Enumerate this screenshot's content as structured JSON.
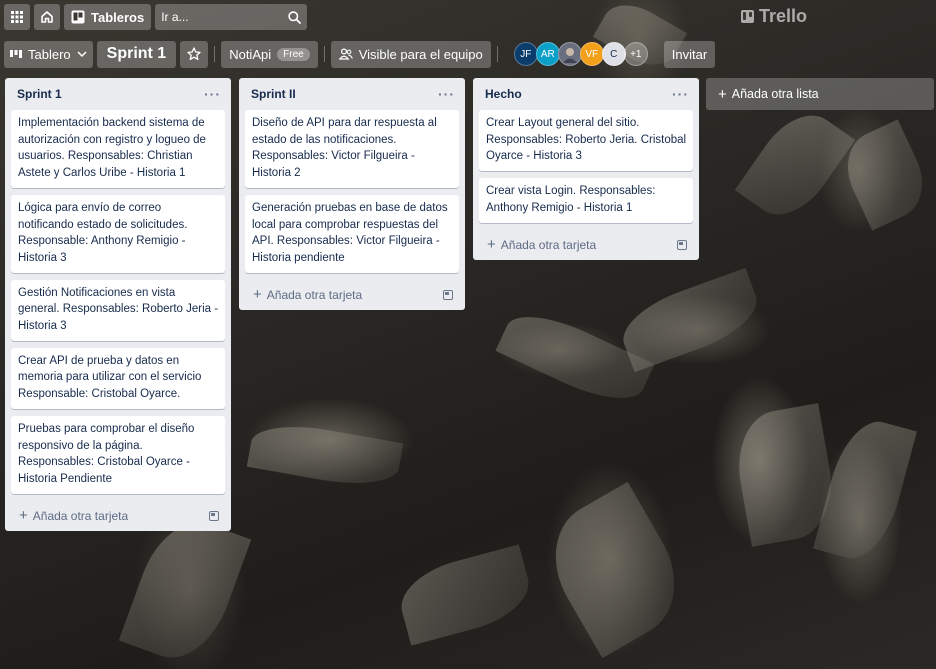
{
  "topbar": {
    "apps_icon": "grid-icon",
    "home_icon": "home-icon",
    "boards_label": "Tableros",
    "search_placeholder": "Ir a...",
    "logo_text": "Trello"
  },
  "boardbar": {
    "view_label": "Tablero",
    "board_title": "Sprint 1",
    "workspace_name": "NotiApi",
    "workspace_badge": "Free",
    "visibility_label": "Visible para el equipo",
    "members": [
      {
        "initials": "JF",
        "color": "#0a3d6b"
      },
      {
        "initials": "AR",
        "color": "#0aa0c7"
      },
      {
        "initials": "",
        "color": "#6a6f80"
      },
      {
        "initials": "VF",
        "color": "#f29f1a"
      },
      {
        "initials": "C",
        "color": "#dfe1e6"
      }
    ],
    "more_members": "+1",
    "invite_label": "Invitar"
  },
  "lists": [
    {
      "title": "Sprint 1",
      "cards": [
        "Implementación backend sistema de autorización con registro y logueo de usuarios. Responsables: Christian Astete y Carlos Uribe - Historia 1",
        "Lógica para envío de correo notificando estado de solicitudes. Responsable: Anthony Remigio - Historia 3",
        "Gestión Notificaciones en vista general. Responsables: Roberto Jeria - Historia 3",
        "Crear API de prueba y datos en memoria para utilizar con el servicio Responsable: Cristobal Oyarce.",
        "Pruebas para comprobar el diseño responsivo de la página. Responsables: Cristobal Oyarce - Historia Pendiente"
      ],
      "add_label": "Añada otra tarjeta"
    },
    {
      "title": "Sprint II",
      "cards": [
        "Diseño de API para dar respuesta al estado de las notificaciones. Responsables: Victor Filgueira - Historia 2",
        "Generación pruebas en base de datos local para comprobar respuestas del API. Responsables: Victor Filgueira - Historia pendiente"
      ],
      "add_label": "Añada otra tarjeta"
    },
    {
      "title": "Hecho",
      "cards": [
        "Crear Layout general del sitio. Responsables: Roberto Jeria. Cristobal Oyarce - Historia 3",
        "Crear vista Login. Responsables: Anthony Remigio - Historia 1"
      ],
      "add_label": "Añada otra tarjeta"
    }
  ],
  "add_list_label": "Añada otra lista"
}
